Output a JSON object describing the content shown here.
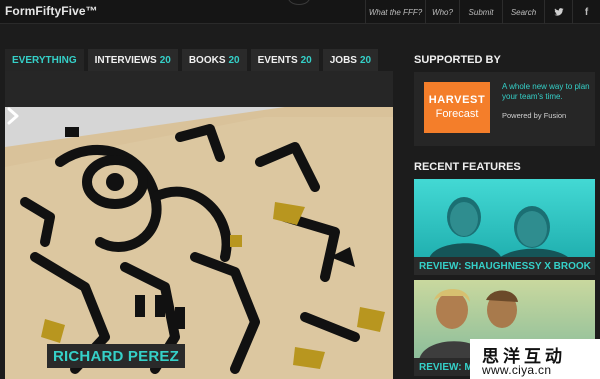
{
  "site": {
    "logo": "FormFiftyFive™"
  },
  "nav": {
    "items": [
      {
        "label": "What the FFF?"
      },
      {
        "label": "Who?"
      },
      {
        "label": "Submit"
      },
      {
        "label": "Search"
      }
    ],
    "social": [
      {
        "icon": "twitter-icon"
      },
      {
        "icon": "facebook-icon",
        "label": "f"
      }
    ]
  },
  "tabs": [
    {
      "label": "EVERYTHING",
      "count": "",
      "active": true
    },
    {
      "label": "INTERVIEWS",
      "count": "20"
    },
    {
      "label": "BOOKS",
      "count": "20"
    },
    {
      "label": "EVENTS",
      "count": "20"
    },
    {
      "label": "JOBS",
      "count": "20"
    }
  ],
  "featured": {
    "title": "RICHARD PEREZ",
    "arrow_icon": "chevron-right-icon"
  },
  "sidebar": {
    "supported_heading": "SUPPORTED BY",
    "sponsor": {
      "logo_line1": "HARVEST",
      "logo_line2": "Forecast",
      "tagline": "A whole new way to plan your team's time.",
      "powered": "Powered by Fusion"
    },
    "recent_heading": "RECENT FEATURES",
    "recent": [
      {
        "caption": "REVIEW: SHAUGHNESSY X BROOK"
      },
      {
        "caption": "REVIEW: MAG"
      }
    ]
  },
  "watermark": {
    "top": "思洋互动",
    "bottom": "www.ciya.cn"
  },
  "colors": {
    "accent": "#35d0c8",
    "background": "#1c1c1c",
    "sponsor_orange": "#f47e2a"
  }
}
